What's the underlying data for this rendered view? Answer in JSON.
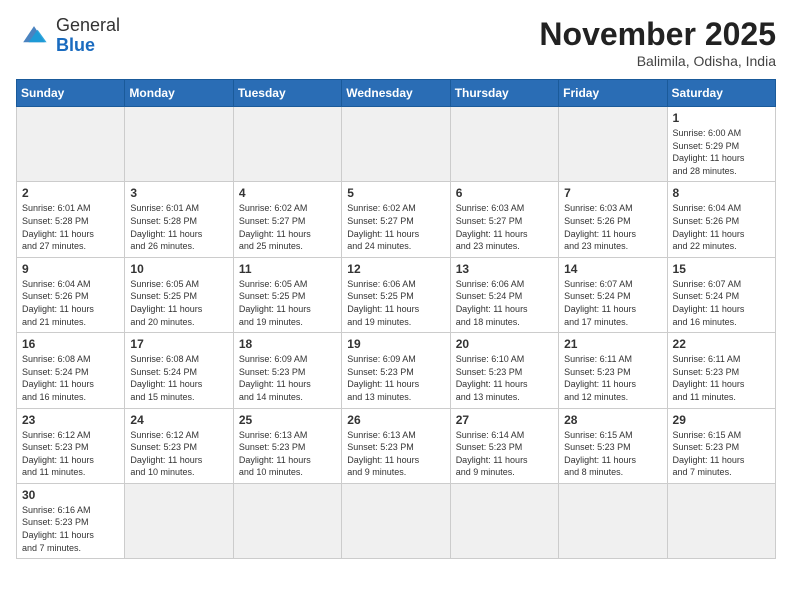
{
  "header": {
    "logo_general": "General",
    "logo_blue": "Blue",
    "month_title": "November 2025",
    "location": "Balimila, Odisha, India"
  },
  "weekdays": [
    "Sunday",
    "Monday",
    "Tuesday",
    "Wednesday",
    "Thursday",
    "Friday",
    "Saturday"
  ],
  "weeks": [
    [
      {
        "day": "",
        "info": ""
      },
      {
        "day": "",
        "info": ""
      },
      {
        "day": "",
        "info": ""
      },
      {
        "day": "",
        "info": ""
      },
      {
        "day": "",
        "info": ""
      },
      {
        "day": "",
        "info": ""
      },
      {
        "day": "1",
        "info": "Sunrise: 6:00 AM\nSunset: 5:29 PM\nDaylight: 11 hours\nand 28 minutes."
      }
    ],
    [
      {
        "day": "2",
        "info": "Sunrise: 6:01 AM\nSunset: 5:28 PM\nDaylight: 11 hours\nand 27 minutes."
      },
      {
        "day": "3",
        "info": "Sunrise: 6:01 AM\nSunset: 5:28 PM\nDaylight: 11 hours\nand 26 minutes."
      },
      {
        "day": "4",
        "info": "Sunrise: 6:02 AM\nSunset: 5:27 PM\nDaylight: 11 hours\nand 25 minutes."
      },
      {
        "day": "5",
        "info": "Sunrise: 6:02 AM\nSunset: 5:27 PM\nDaylight: 11 hours\nand 24 minutes."
      },
      {
        "day": "6",
        "info": "Sunrise: 6:03 AM\nSunset: 5:27 PM\nDaylight: 11 hours\nand 23 minutes."
      },
      {
        "day": "7",
        "info": "Sunrise: 6:03 AM\nSunset: 5:26 PM\nDaylight: 11 hours\nand 23 minutes."
      },
      {
        "day": "8",
        "info": "Sunrise: 6:04 AM\nSunset: 5:26 PM\nDaylight: 11 hours\nand 22 minutes."
      }
    ],
    [
      {
        "day": "9",
        "info": "Sunrise: 6:04 AM\nSunset: 5:26 PM\nDaylight: 11 hours\nand 21 minutes."
      },
      {
        "day": "10",
        "info": "Sunrise: 6:05 AM\nSunset: 5:25 PM\nDaylight: 11 hours\nand 20 minutes."
      },
      {
        "day": "11",
        "info": "Sunrise: 6:05 AM\nSunset: 5:25 PM\nDaylight: 11 hours\nand 19 minutes."
      },
      {
        "day": "12",
        "info": "Sunrise: 6:06 AM\nSunset: 5:25 PM\nDaylight: 11 hours\nand 19 minutes."
      },
      {
        "day": "13",
        "info": "Sunrise: 6:06 AM\nSunset: 5:24 PM\nDaylight: 11 hours\nand 18 minutes."
      },
      {
        "day": "14",
        "info": "Sunrise: 6:07 AM\nSunset: 5:24 PM\nDaylight: 11 hours\nand 17 minutes."
      },
      {
        "day": "15",
        "info": "Sunrise: 6:07 AM\nSunset: 5:24 PM\nDaylight: 11 hours\nand 16 minutes."
      }
    ],
    [
      {
        "day": "16",
        "info": "Sunrise: 6:08 AM\nSunset: 5:24 PM\nDaylight: 11 hours\nand 16 minutes."
      },
      {
        "day": "17",
        "info": "Sunrise: 6:08 AM\nSunset: 5:24 PM\nDaylight: 11 hours\nand 15 minutes."
      },
      {
        "day": "18",
        "info": "Sunrise: 6:09 AM\nSunset: 5:23 PM\nDaylight: 11 hours\nand 14 minutes."
      },
      {
        "day": "19",
        "info": "Sunrise: 6:09 AM\nSunset: 5:23 PM\nDaylight: 11 hours\nand 13 minutes."
      },
      {
        "day": "20",
        "info": "Sunrise: 6:10 AM\nSunset: 5:23 PM\nDaylight: 11 hours\nand 13 minutes."
      },
      {
        "day": "21",
        "info": "Sunrise: 6:11 AM\nSunset: 5:23 PM\nDaylight: 11 hours\nand 12 minutes."
      },
      {
        "day": "22",
        "info": "Sunrise: 6:11 AM\nSunset: 5:23 PM\nDaylight: 11 hours\nand 11 minutes."
      }
    ],
    [
      {
        "day": "23",
        "info": "Sunrise: 6:12 AM\nSunset: 5:23 PM\nDaylight: 11 hours\nand 11 minutes."
      },
      {
        "day": "24",
        "info": "Sunrise: 6:12 AM\nSunset: 5:23 PM\nDaylight: 11 hours\nand 10 minutes."
      },
      {
        "day": "25",
        "info": "Sunrise: 6:13 AM\nSunset: 5:23 PM\nDaylight: 11 hours\nand 10 minutes."
      },
      {
        "day": "26",
        "info": "Sunrise: 6:13 AM\nSunset: 5:23 PM\nDaylight: 11 hours\nand 9 minutes."
      },
      {
        "day": "27",
        "info": "Sunrise: 6:14 AM\nSunset: 5:23 PM\nDaylight: 11 hours\nand 9 minutes."
      },
      {
        "day": "28",
        "info": "Sunrise: 6:15 AM\nSunset: 5:23 PM\nDaylight: 11 hours\nand 8 minutes."
      },
      {
        "day": "29",
        "info": "Sunrise: 6:15 AM\nSunset: 5:23 PM\nDaylight: 11 hours\nand 7 minutes."
      }
    ],
    [
      {
        "day": "30",
        "info": "Sunrise: 6:16 AM\nSunset: 5:23 PM\nDaylight: 11 hours\nand 7 minutes."
      },
      {
        "day": "",
        "info": ""
      },
      {
        "day": "",
        "info": ""
      },
      {
        "day": "",
        "info": ""
      },
      {
        "day": "",
        "info": ""
      },
      {
        "day": "",
        "info": ""
      },
      {
        "day": "",
        "info": ""
      }
    ]
  ]
}
